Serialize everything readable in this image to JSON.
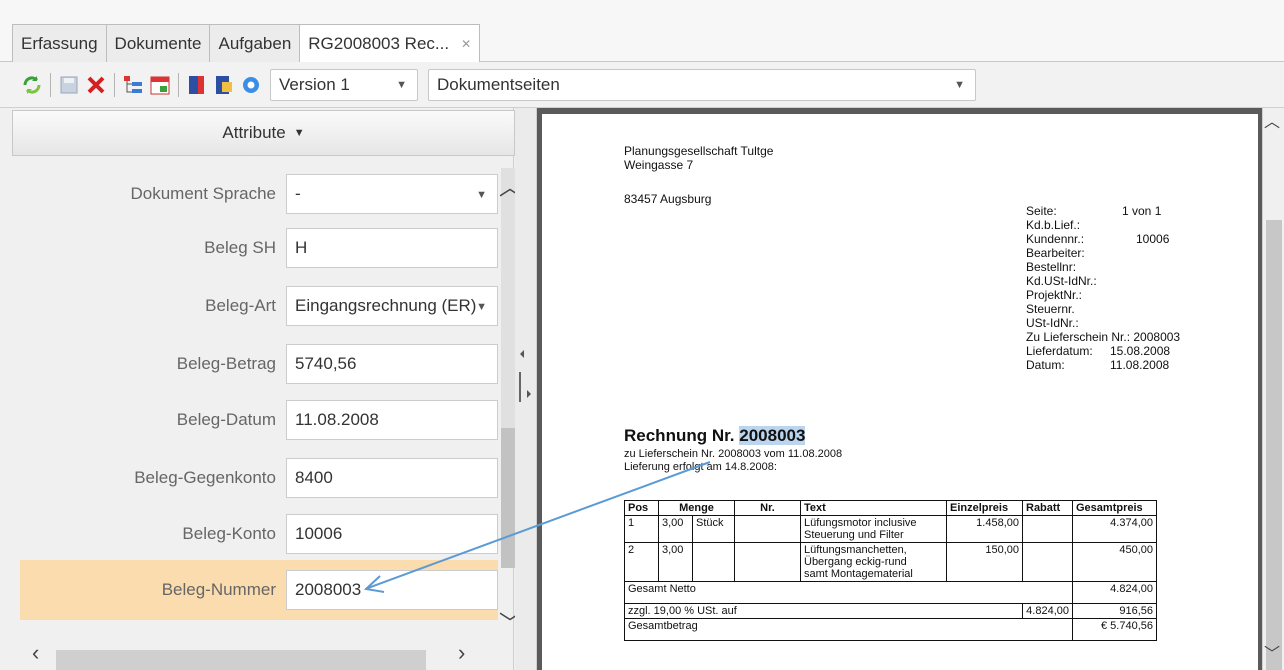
{
  "tabs": [
    {
      "label": "Erfassung"
    },
    {
      "label": "Dokumente"
    },
    {
      "label": "Aufgaben"
    },
    {
      "label": "RG2008003 Rec..."
    }
  ],
  "tab_close_symbol": "✕",
  "toolbar": {
    "icons": [
      "refresh-icon",
      "save-icon",
      "delete-icon",
      "tree-icon",
      "calendar-icon",
      "book-icon",
      "document-info-icon",
      "settings-icon"
    ],
    "version_select": "Version 1",
    "pages_select": "Dokumentseiten"
  },
  "attributes": {
    "header": "Attribute",
    "rows": [
      {
        "label": "Dokument Sprache",
        "value": "-",
        "type": "select"
      },
      {
        "label": "Beleg SH",
        "value": "H",
        "type": "text"
      },
      {
        "label": "Beleg-Art",
        "value": "Eingangsrechnung (ER)",
        "type": "select"
      },
      {
        "label": "Beleg-Betrag",
        "value": "5740,56",
        "type": "text"
      },
      {
        "label": "Beleg-Datum",
        "value": "11.08.2008",
        "type": "text"
      },
      {
        "label": "Beleg-Gegenkonto",
        "value": "8400",
        "type": "text"
      },
      {
        "label": "Beleg-Konto",
        "value": "10006",
        "type": "text"
      },
      {
        "label": "Beleg-Nummer",
        "value": "2008003",
        "type": "text"
      }
    ]
  },
  "document": {
    "sender_name": "Planungsgesellschaft Tultge",
    "sender_street": "Weingasse 7",
    "sender_city": "83457 Augsburg",
    "meta": [
      {
        "label": "Seite:",
        "value": "1 von 1"
      },
      {
        "label": "Kd.b.Lief.:",
        "value": ""
      },
      {
        "label": "Kundennr.:",
        "value": "10006"
      },
      {
        "label": "Bearbeiter:",
        "value": ""
      },
      {
        "label": "Bestellnr:",
        "value": ""
      },
      {
        "label": "Kd.USt-IdNr.:",
        "value": ""
      },
      {
        "label": "ProjektNr.:",
        "value": ""
      },
      {
        "label": "Steuernr.",
        "value": ""
      },
      {
        "label": "USt-IdNr.:",
        "value": ""
      }
    ],
    "lieferschein_line": "Zu Lieferschein Nr.: 2008003",
    "lieferdatum_label": "Lieferdatum:",
    "lieferdatum_value": "15.08.2008",
    "datum_label": "Datum:",
    "datum_value": "11.08.2008",
    "title_prefix": "Rechnung Nr.",
    "title_number": "2008003",
    "sub1": "zu Lieferschein Nr. 2008003 vom 11.08.2008",
    "sub2": "Lieferung erfolgt am 14.8.2008:",
    "table_headers": [
      "Pos",
      "Menge",
      "Nr.",
      "Text",
      "Einzelpreis",
      "Rabatt",
      "Gesamtpreis"
    ],
    "items": [
      {
        "pos": "1",
        "menge": "3,00",
        "unit": "Stück",
        "nr": "",
        "text1": "Lüfungsmotor inclusive",
        "text2": "Steuerung und Filter",
        "text3": "",
        "einzel": "1.458,00",
        "rabatt": "",
        "gesamt": "4.374,00"
      },
      {
        "pos": "2",
        "menge": "3,00",
        "unit": "",
        "nr": "",
        "text1": "Lüftungsmanchetten,",
        "text2": "Übergang eckig-rund",
        "text3": "samt Montagematerial",
        "einzel": "150,00",
        "rabatt": "",
        "gesamt": "450,00"
      }
    ],
    "netto_label": "Gesamt Netto",
    "netto_value": "4.824,00",
    "ust_label": "zzgl. 19,00 % USt. auf",
    "ust_base": "4.824,00",
    "ust_value": "916,56",
    "total_label": "Gesamtbetrag",
    "total_value": "€ 5.740,56"
  },
  "colors": {
    "highlight_row": "#fbdcae",
    "arrow": "#5b9bd5",
    "number_highlight": "#bcd5ee"
  }
}
